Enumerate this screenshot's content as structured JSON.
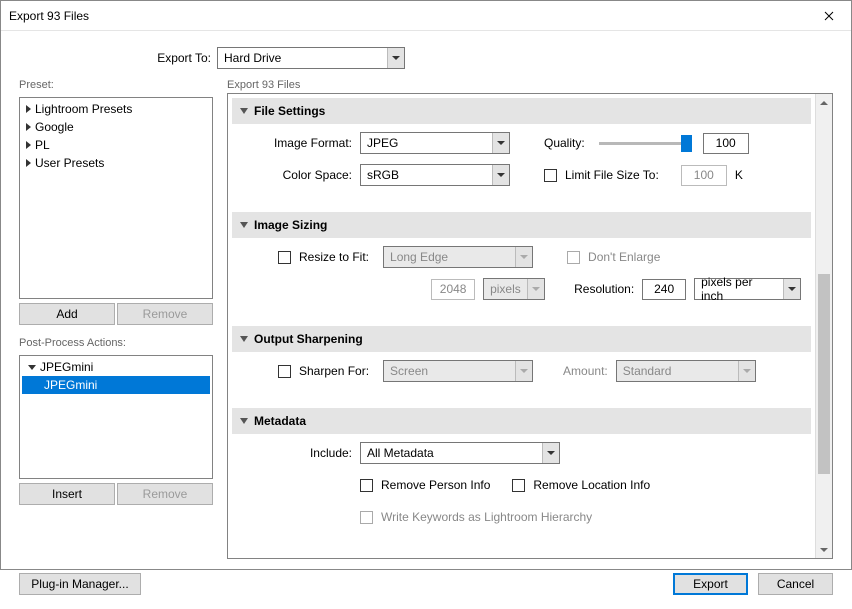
{
  "title": "Export 93 Files",
  "exportTo": {
    "label": "Export To:",
    "value": "Hard Drive"
  },
  "preset": {
    "label": "Preset:",
    "items": [
      "Lightroom Presets",
      "Google",
      "PL",
      "User Presets"
    ],
    "addLabel": "Add",
    "removeLabel": "Remove"
  },
  "actions": {
    "label": "Post-Process Actions:",
    "group": "JPEGmini",
    "item": "JPEGmini",
    "insertLabel": "Insert",
    "removeLabel": "Remove"
  },
  "panel": {
    "title": "Export 93 Files",
    "fileSettings": {
      "header": "File Settings",
      "imageFormatLabel": "Image Format:",
      "imageFormat": "JPEG",
      "qualityLabel": "Quality:",
      "quality": "100",
      "colorSpaceLabel": "Color Space:",
      "colorSpace": "sRGB",
      "limitLabel": "Limit File Size To:",
      "limitValue": "100",
      "limitUnit": "K"
    },
    "imageSizing": {
      "header": "Image Sizing",
      "resizeLabel": "Resize to Fit:",
      "resizeMode": "Long Edge",
      "dontEnlarge": "Don't Enlarge",
      "dim": "2048",
      "dimUnit": "pixels",
      "resolutionLabel": "Resolution:",
      "resolution": "240",
      "resolutionUnit": "pixels per inch"
    },
    "sharpen": {
      "header": "Output Sharpening",
      "sharpenForLabel": "Sharpen For:",
      "sharpenFor": "Screen",
      "amountLabel": "Amount:",
      "amount": "Standard"
    },
    "metadata": {
      "header": "Metadata",
      "includeLabel": "Include:",
      "include": "All Metadata",
      "removePerson": "Remove Person Info",
      "removeLocation": "Remove Location Info",
      "writeKeywords": "Write Keywords as Lightroom Hierarchy"
    }
  },
  "footer": {
    "plugin": "Plug-in Manager...",
    "export": "Export",
    "cancel": "Cancel"
  }
}
